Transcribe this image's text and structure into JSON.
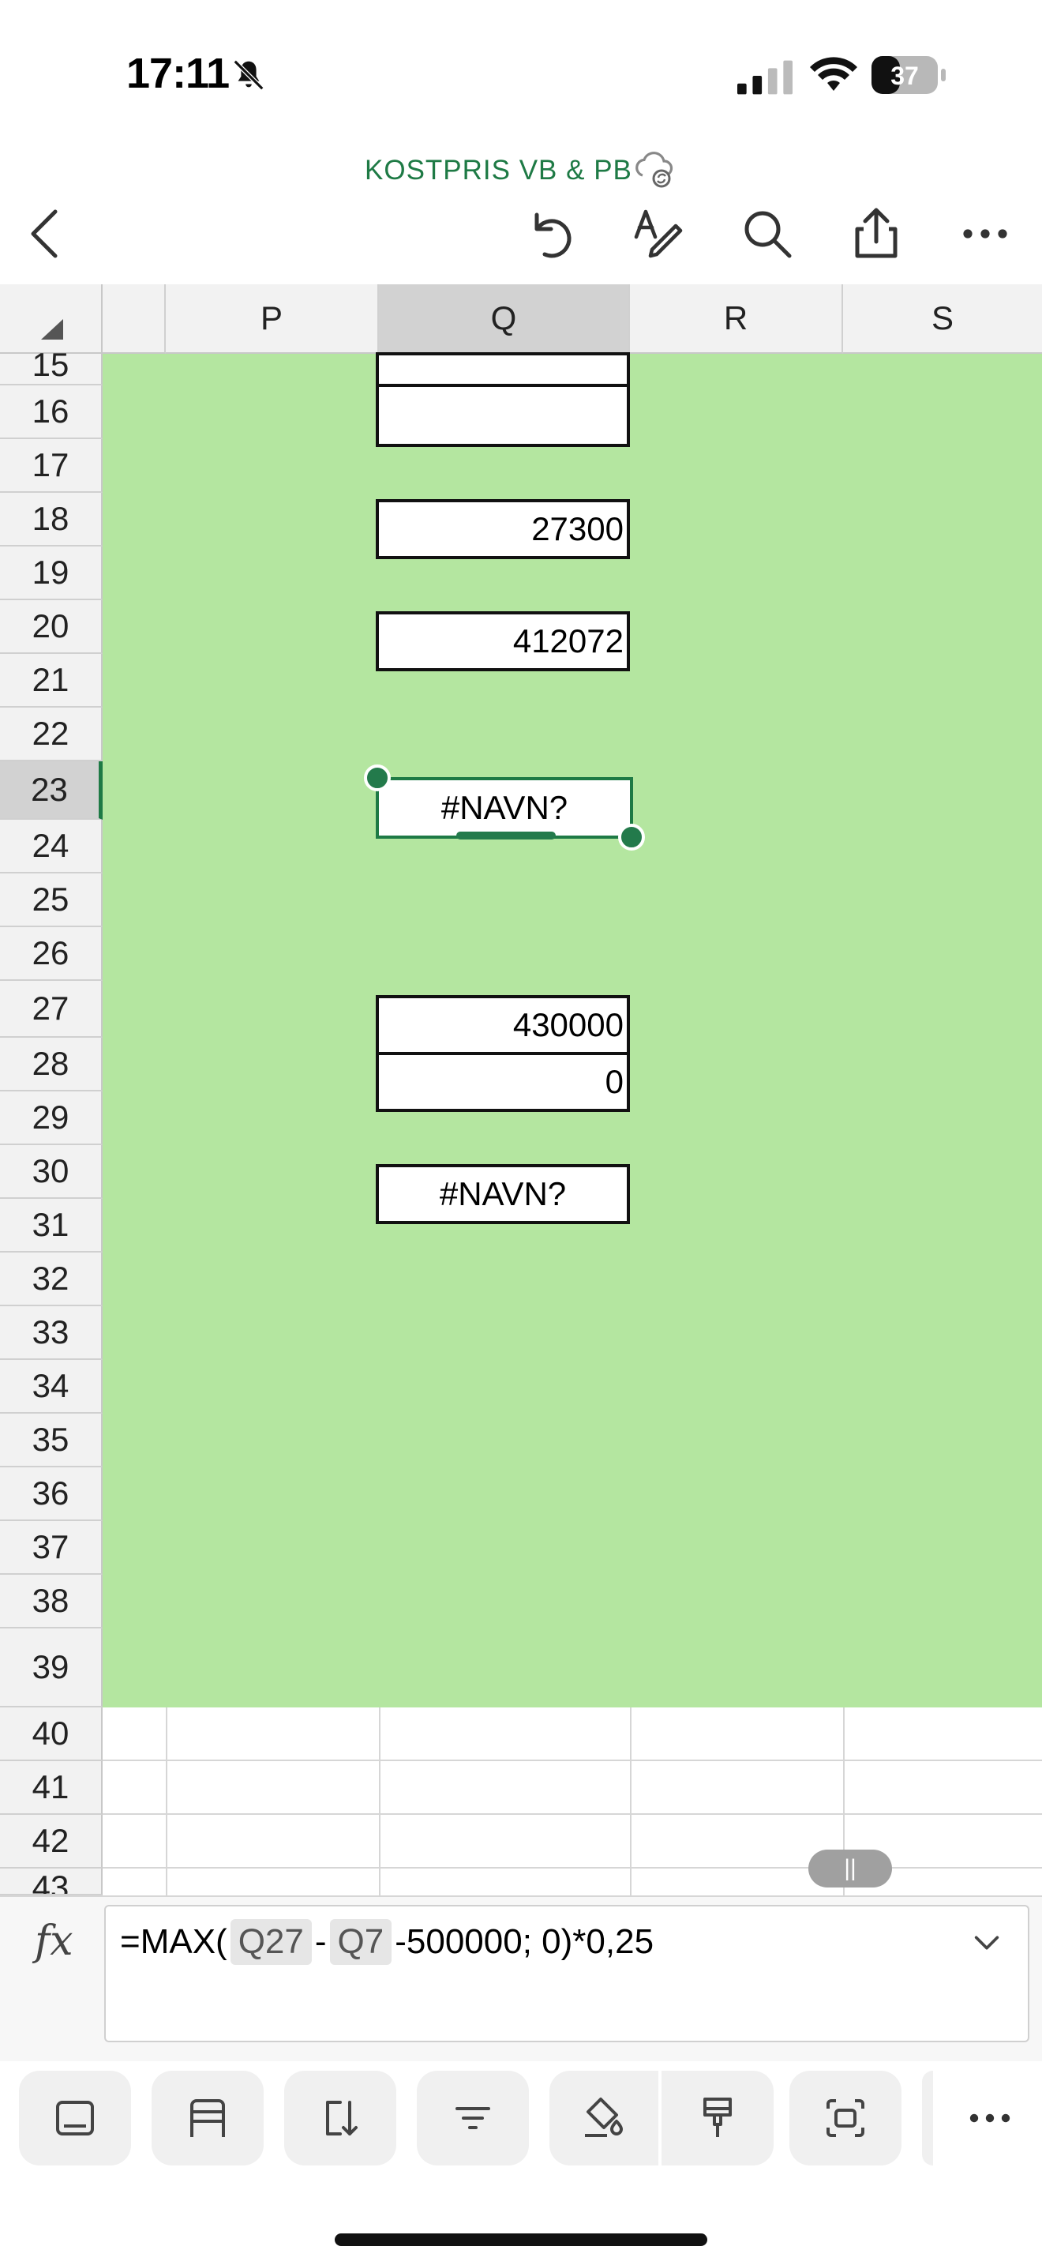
{
  "status": {
    "time": "17:11",
    "battery": "37"
  },
  "document": {
    "title": "KOSTPRIS VB & PB"
  },
  "columns": [
    "P",
    "Q",
    "R",
    "S"
  ],
  "rows": [
    "15",
    "16",
    "17",
    "18",
    "19",
    "20",
    "21",
    "22",
    "23",
    "24",
    "25",
    "26",
    "27",
    "28",
    "29",
    "30",
    "31",
    "32",
    "33",
    "34",
    "35",
    "36",
    "37",
    "38",
    "39",
    "40",
    "41",
    "42",
    "43"
  ],
  "cells": {
    "q18": "27300",
    "q20": "412072",
    "q23": "#NAVN?",
    "q27": "430000",
    "q28": "0",
    "q30": "#NAVN?"
  },
  "formula": {
    "prefix": "=MAX(",
    "ref1": "Q27",
    "minus": "-",
    "ref2": "Q7",
    "suffix": "-500000; 0)*0,25"
  },
  "colors": {
    "accent": "#1e7a45",
    "fill": "#b4e6a0"
  },
  "icons": [
    "back-icon",
    "undo-icon",
    "draw-icon",
    "search-icon",
    "share-icon",
    "more-icon",
    "cloud-sync-icon",
    "fx-icon",
    "chevron-down-icon"
  ],
  "scroll_pill": "||"
}
